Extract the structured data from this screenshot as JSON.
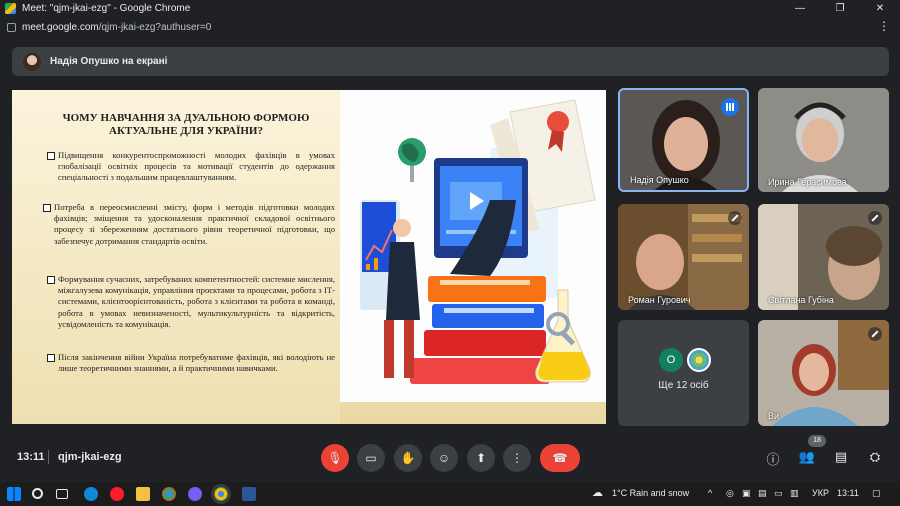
{
  "window": {
    "title": "Meet: \"qjm-jkai-ezg\" - Google Chrome",
    "url_host": "meet.google.com",
    "url_path": "/qjm-jkai-ezg?authuser=0",
    "controls": [
      "—",
      "❐",
      "✕"
    ]
  },
  "banner": {
    "text": "Надія Опушко на екрані"
  },
  "slide": {
    "title": "ЧОМУ НАВЧАННЯ ЗА ДУАЛЬНОЮ ФОРМОЮ АКТУАЛЬНЕ ДЛЯ УКРАЇНИ?",
    "bullets": [
      "Підвищення конкурентоспроможності молодих фахівців в умовах глобалізації освітніх процесів та мотивації студентів до одержання спеціальності з подальшим працевлаштуванням.",
      "Потреба в переосмисленні змісту, форм і методів підготовки молодих фахівців; зміщення та удосконалення практичної складової освітнього процесу зі збереженням достатнього рівня теоретичної підготовки, що забезпечує дотримання стандартів освіти.",
      "Формування сучасних, затребуваних компетентностей: системне мислення, міжгалузева комунікація, управління проєктами та процесами, робота з ІТ-системами, клієнтоорієнтованість, робота з клієнтами та робота в команді, робота в умовах невизначеності, мультикультурність та відкритість, усвідомленість та комунікація.",
      "Після закінчення війни Україна потребуватиме фахівців, які володіють не лише теоретичними знаннями, а й практичними навичками."
    ]
  },
  "participants": [
    {
      "name": "Надія Опушко"
    },
    {
      "name": "Ирина Герасимова"
    },
    {
      "name": "Роман Гурович"
    },
    {
      "name": "Світлана Губіна"
    },
    {
      "name": "Ви"
    }
  ],
  "others": {
    "initial": "O",
    "count_label": "Ще 12 осіб"
  },
  "bottom": {
    "time": "13:11",
    "meeting_code": "qjm-jkai-ezg",
    "participants_badge": "18"
  },
  "taskbar": {
    "weather": "1°C  Rain and snow",
    "lang": "УКР",
    "clock": "13:11"
  },
  "colors": {
    "end_call": "#ea4335",
    "speaking": "#1a73e8",
    "bg": "#202124"
  }
}
